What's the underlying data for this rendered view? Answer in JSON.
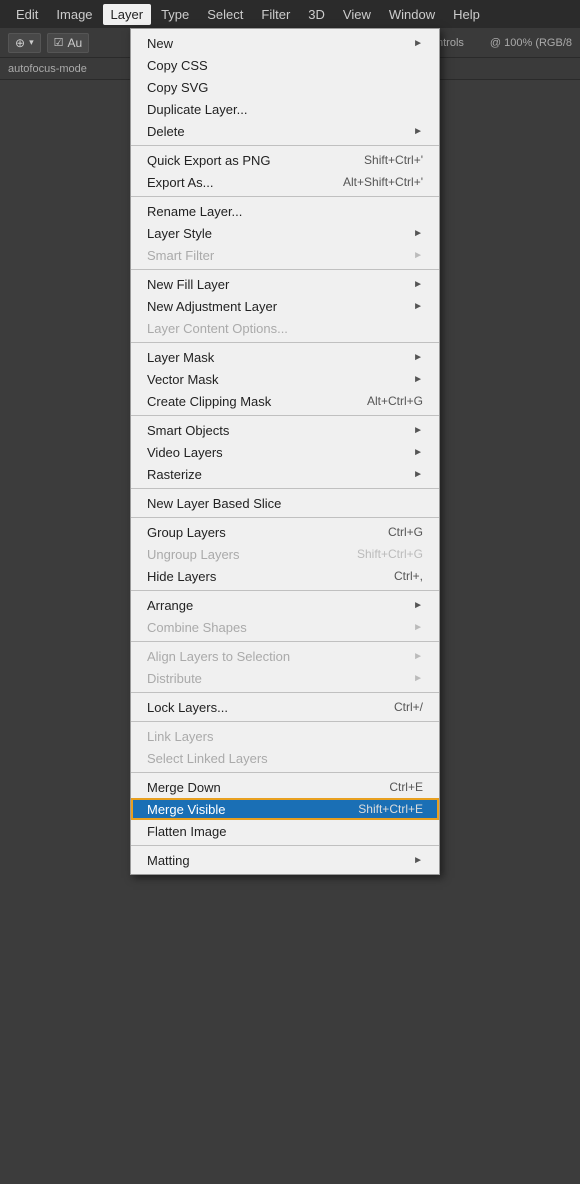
{
  "menubar": {
    "items": [
      {
        "label": "Edit",
        "active": false
      },
      {
        "label": "Image",
        "active": false
      },
      {
        "label": "Layer",
        "active": true
      },
      {
        "label": "Type",
        "active": false
      },
      {
        "label": "Select",
        "active": false
      },
      {
        "label": "Filter",
        "active": false
      },
      {
        "label": "3D",
        "active": false
      },
      {
        "label": "View",
        "active": false
      },
      {
        "label": "Window",
        "active": false
      },
      {
        "label": "Help",
        "active": false
      }
    ]
  },
  "toolbar": {
    "move_tool": "⊕",
    "auto_label": "Au",
    "controls_label": "Controls",
    "zoom_label": "@ 100% (RGB/8"
  },
  "breadcrumb": {
    "text": "autofocus-mode"
  },
  "menu": {
    "sections": [
      {
        "items": [
          {
            "label": "New",
            "shortcut": "",
            "has_arrow": true,
            "disabled": false
          },
          {
            "label": "Copy CSS",
            "shortcut": "",
            "has_arrow": false,
            "disabled": false
          },
          {
            "label": "Copy SVG",
            "shortcut": "",
            "has_arrow": false,
            "disabled": false
          },
          {
            "label": "Duplicate Layer...",
            "shortcut": "",
            "has_arrow": false,
            "disabled": false
          },
          {
            "label": "Delete",
            "shortcut": "",
            "has_arrow": true,
            "disabled": false
          }
        ]
      },
      {
        "items": [
          {
            "label": "Quick Export as PNG",
            "shortcut": "Shift+Ctrl+'",
            "has_arrow": false,
            "disabled": false
          },
          {
            "label": "Export As...",
            "shortcut": "Alt+Shift+Ctrl+'",
            "has_arrow": false,
            "disabled": false
          }
        ]
      },
      {
        "items": [
          {
            "label": "Rename Layer...",
            "shortcut": "",
            "has_arrow": false,
            "disabled": false
          },
          {
            "label": "Layer Style",
            "shortcut": "",
            "has_arrow": true,
            "disabled": false
          },
          {
            "label": "Smart Filter",
            "shortcut": "",
            "has_arrow": true,
            "disabled": true
          }
        ]
      },
      {
        "items": [
          {
            "label": "New Fill Layer",
            "shortcut": "",
            "has_arrow": true,
            "disabled": false
          },
          {
            "label": "New Adjustment Layer",
            "shortcut": "",
            "has_arrow": true,
            "disabled": false
          },
          {
            "label": "Layer Content Options...",
            "shortcut": "",
            "has_arrow": false,
            "disabled": true
          }
        ]
      },
      {
        "items": [
          {
            "label": "Layer Mask",
            "shortcut": "",
            "has_arrow": true,
            "disabled": false
          },
          {
            "label": "Vector Mask",
            "shortcut": "",
            "has_arrow": true,
            "disabled": false
          },
          {
            "label": "Create Clipping Mask",
            "shortcut": "Alt+Ctrl+G",
            "has_arrow": false,
            "disabled": false
          }
        ]
      },
      {
        "items": [
          {
            "label": "Smart Objects",
            "shortcut": "",
            "has_arrow": true,
            "disabled": false
          },
          {
            "label": "Video Layers",
            "shortcut": "",
            "has_arrow": true,
            "disabled": false
          },
          {
            "label": "Rasterize",
            "shortcut": "",
            "has_arrow": true,
            "disabled": false
          }
        ]
      },
      {
        "items": [
          {
            "label": "New Layer Based Slice",
            "shortcut": "",
            "has_arrow": false,
            "disabled": false
          }
        ]
      },
      {
        "items": [
          {
            "label": "Group Layers",
            "shortcut": "Ctrl+G",
            "has_arrow": false,
            "disabled": false
          },
          {
            "label": "Ungroup Layers",
            "shortcut": "Shift+Ctrl+G",
            "has_arrow": false,
            "disabled": true
          },
          {
            "label": "Hide Layers",
            "shortcut": "Ctrl+,",
            "has_arrow": false,
            "disabled": false
          }
        ]
      },
      {
        "items": [
          {
            "label": "Arrange",
            "shortcut": "",
            "has_arrow": true,
            "disabled": false
          },
          {
            "label": "Combine Shapes",
            "shortcut": "",
            "has_arrow": true,
            "disabled": true
          }
        ]
      },
      {
        "items": [
          {
            "label": "Align Layers to Selection",
            "shortcut": "",
            "has_arrow": true,
            "disabled": true
          },
          {
            "label": "Distribute",
            "shortcut": "",
            "has_arrow": true,
            "disabled": true
          }
        ]
      },
      {
        "items": [
          {
            "label": "Lock Layers...",
            "shortcut": "Ctrl+/",
            "has_arrow": false,
            "disabled": false
          }
        ]
      },
      {
        "items": [
          {
            "label": "Link Layers",
            "shortcut": "",
            "has_arrow": false,
            "disabled": true
          },
          {
            "label": "Select Linked Layers",
            "shortcut": "",
            "has_arrow": false,
            "disabled": true
          }
        ]
      },
      {
        "items": [
          {
            "label": "Merge Down",
            "shortcut": "Ctrl+E",
            "has_arrow": false,
            "disabled": false
          },
          {
            "label": "Merge Visible",
            "shortcut": "Shift+Ctrl+E",
            "has_arrow": false,
            "disabled": false,
            "highlighted": true
          },
          {
            "label": "Flatten Image",
            "shortcut": "",
            "has_arrow": false,
            "disabled": false
          }
        ]
      },
      {
        "items": [
          {
            "label": "Matting",
            "shortcut": "",
            "has_arrow": true,
            "disabled": false
          }
        ]
      }
    ]
  }
}
